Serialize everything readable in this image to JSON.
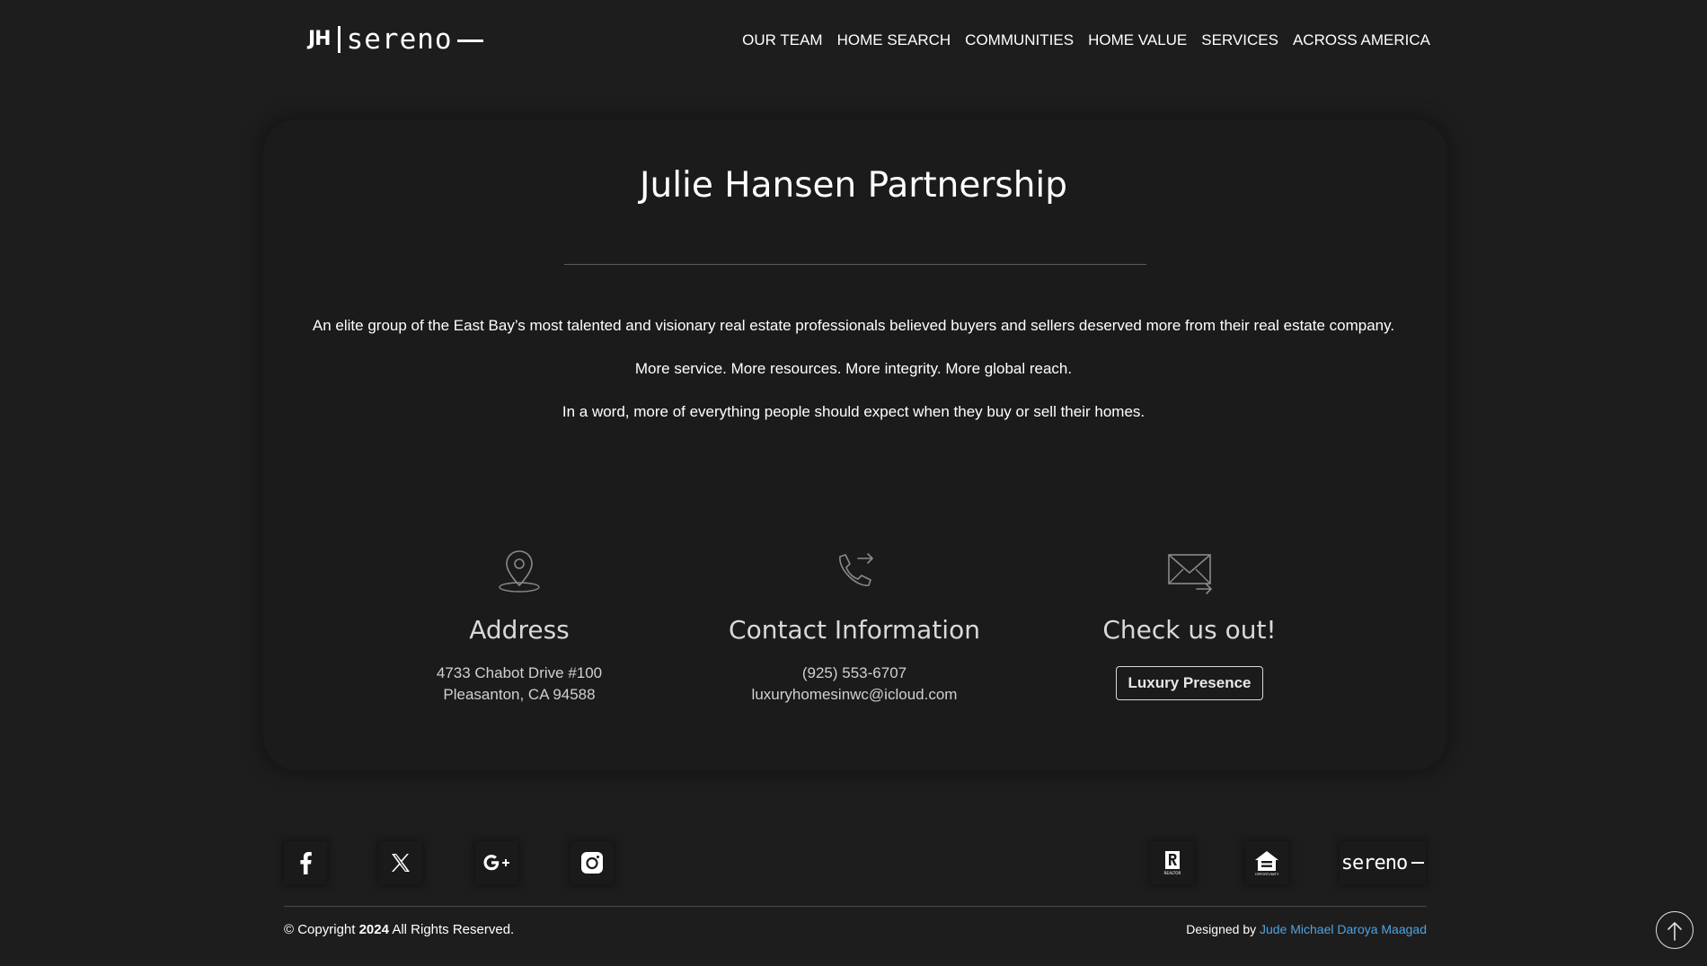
{
  "header": {
    "logo": {
      "initials": "JH",
      "word": "sereno"
    },
    "nav": [
      {
        "label": "OUR TEAM"
      },
      {
        "label": "HOME SEARCH"
      },
      {
        "label": "COMMUNITIES"
      },
      {
        "label": "HOME VALUE"
      },
      {
        "label": "SERVICES"
      },
      {
        "label": "ACROSS AMERICA"
      }
    ]
  },
  "main": {
    "title": "Julie Hansen Partnership",
    "paragraphs": [
      "An elite group of the East Bay’s most talented and visionary real estate professionals believed buyers and sellers deserved more from their real estate company.",
      "More service. More resources. More integrity. More global reach.",
      "In a word, more of everything people should expect when they buy or sell their homes."
    ],
    "address": {
      "icon": "map-pin-icon",
      "title": "Address",
      "line1": "4733 Chabot Drive #100",
      "line2": "Pleasanton, CA 94588"
    },
    "contact": {
      "icon": "phone-forward-icon",
      "title": "Contact Information",
      "phone": "(925) 553-6707",
      "email": "luxuryhomesinwc@icloud.com"
    },
    "checkout": {
      "icon": "mail-forward-icon",
      "title": "Check us out!",
      "button_label": "Luxury Presence"
    }
  },
  "footer": {
    "social": [
      {
        "icon": "facebook-icon"
      },
      {
        "icon": "x-twitter-icon"
      },
      {
        "icon": "google-plus-icon"
      },
      {
        "icon": "instagram-icon"
      }
    ],
    "badges": [
      {
        "icon": "realtor-icon",
        "caption": "REALTOR"
      },
      {
        "icon": "equal-housing-icon",
        "caption": "OPPORTUNITY"
      },
      {
        "label": "sereno"
      }
    ],
    "copyright_prefix": "© Copyright",
    "copyright_year": "2024",
    "copyright_suffix": "All Rights Reserved.",
    "designed_by_label": "Designed by",
    "designer_name": "Jude Michael Daroya Maagad"
  },
  "colors": {
    "background": "#1d1d1d",
    "card": "#1b1b1b",
    "link": "#4fa3e0",
    "icon_gray": "#8a8a8a"
  }
}
